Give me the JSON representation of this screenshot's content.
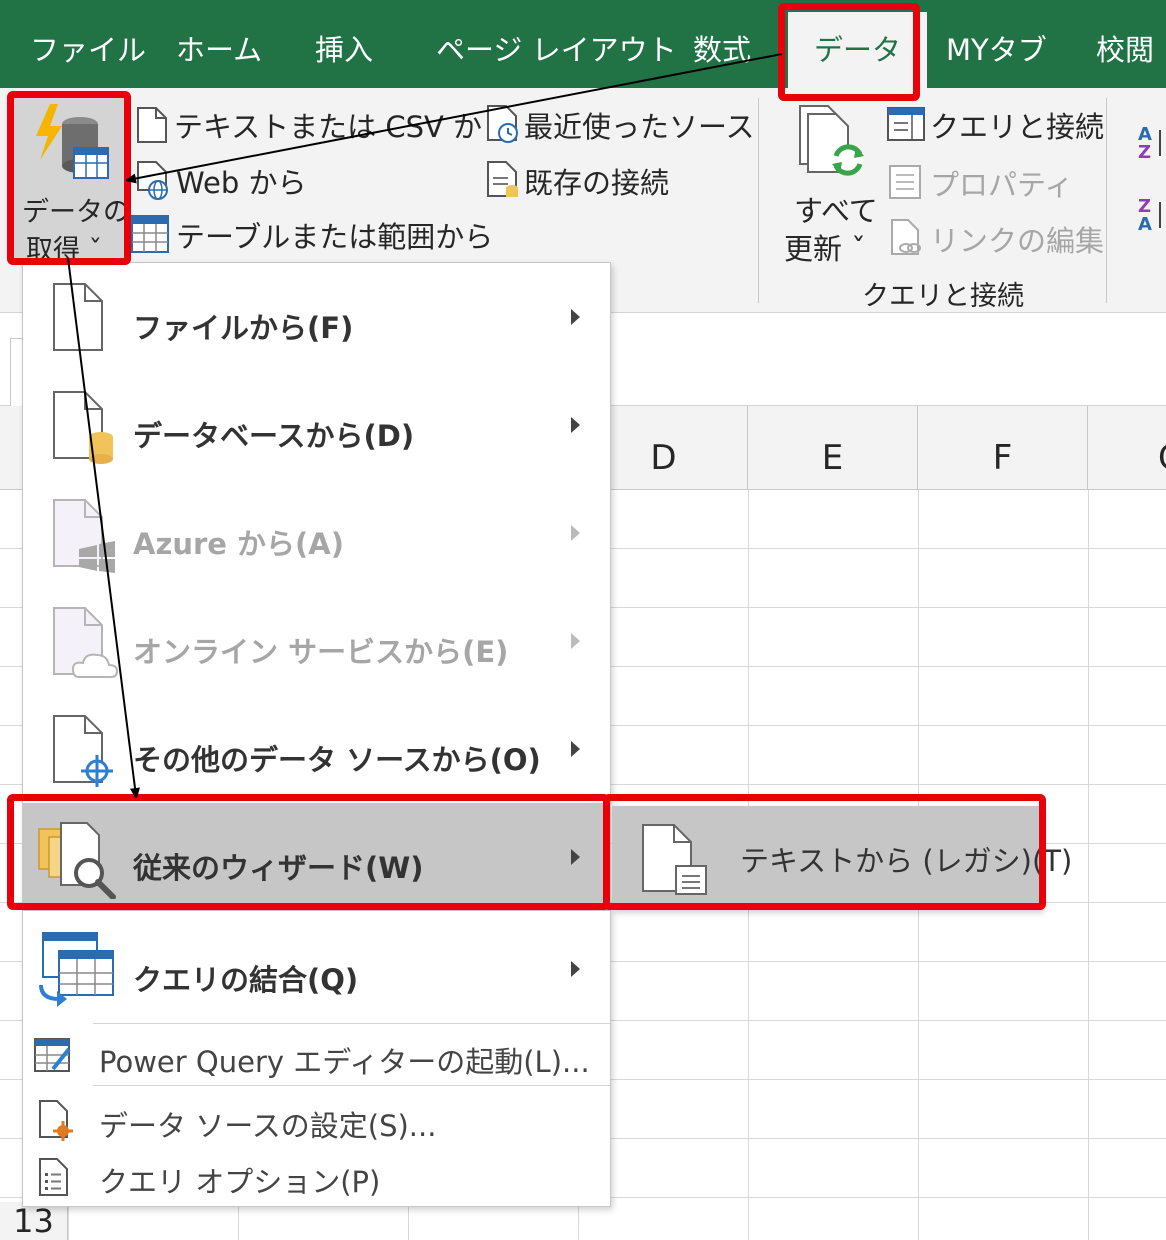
{
  "tabs": {
    "file": "ファイル",
    "home": "ホーム",
    "insert": "挿入",
    "page_layout": "ページ レイアウト",
    "formulas": "数式",
    "data": "データ",
    "mytab": "MYタブ",
    "review": "校閲"
  },
  "ribbon": {
    "get_data_line1": "データの",
    "get_data_line2": "取得 ˇ",
    "text_csv": "テキストまたは CSV から",
    "web": "Web から",
    "table_range": "テーブルまたは範囲から",
    "recent_sources": "最近使ったソース",
    "existing_connections": "既存の接続",
    "refresh_line1": "すべて",
    "refresh_line2": "更新 ˇ",
    "queries_connections": "クエリと接続",
    "properties": "プロパティ",
    "edit_links": "リンクの編集",
    "group_label": "クエリと接続"
  },
  "sheet": {
    "columns": [
      "D",
      "E",
      "F",
      "G"
    ],
    "row_number": "13"
  },
  "menu": {
    "from_file": "ファイルから(F)",
    "from_database": "データベースから(D)",
    "from_azure": "Azure から(A)",
    "from_online": "オンライン サービスから(E)",
    "from_other": "その他のデータ ソースから(O)",
    "legacy_wizard": "従来のウィザード(W)",
    "combine_queries": "クエリの結合(Q)",
    "power_query": "Power Query エディターの起動(L)...",
    "data_source_settings": "データ ソースの設定(S)...",
    "query_options": "クエリ オプション(P)"
  },
  "submenu": {
    "from_text_legacy": "テキストから (レガシ)(T)"
  },
  "colors": {
    "excel_green": "#217346",
    "annotation_red": "#e8000b",
    "ribbon_bg": "#f3f3f3",
    "highlight": "#c6c6c6"
  }
}
